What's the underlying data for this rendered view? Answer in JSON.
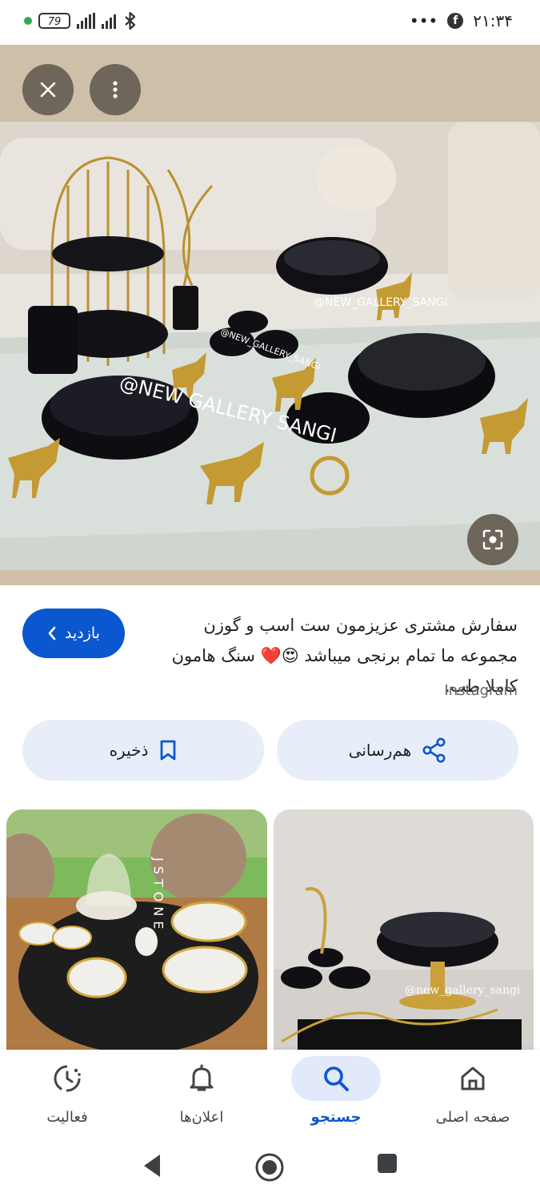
{
  "status_bar": {
    "battery": "79",
    "time": "۲۱:۳۴",
    "more": "•••",
    "facebook_glyph": "f"
  },
  "hero": {
    "watermark_1": "@NEW_GALLERY_SANGI",
    "watermark_2": "@NEW_GALLERY_SANGI",
    "watermark_3": "@NEW GALLERY SANGI"
  },
  "caption": {
    "text": "سفارش مشتری عزیزمون ست اسب و گوزن مجموعه ما تمام برنجی میباشد 😍❤️ سنگ هامون کاملا طب.",
    "source": "Instagram"
  },
  "visit_button": {
    "label": "بازدید"
  },
  "actions": {
    "share_label": "هم‌رسانی",
    "save_label": "ذخیره"
  },
  "thumbnails": {
    "left_watermark": "JSTONE",
    "right_watermark": "@new_gallery_sangi"
  },
  "bottom_nav": {
    "items": [
      {
        "label": "فعالیت",
        "icon": "activity-icon"
      },
      {
        "label": "اعلان‌ها",
        "icon": "bell-icon"
      },
      {
        "label": "جستجو",
        "icon": "search-icon"
      },
      {
        "label": "صفحه اصلی",
        "icon": "home-icon"
      }
    ]
  },
  "colors": {
    "accent": "#0b57d0",
    "chip_bg": "#e8eef9",
    "active_nav_bg": "#e1e9fb"
  }
}
